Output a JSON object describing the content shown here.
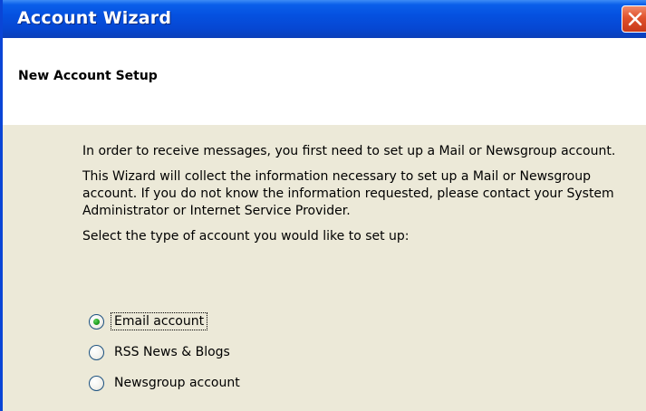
{
  "window": {
    "title": "Account Wizard"
  },
  "header": {
    "title": "New Account Setup"
  },
  "body": {
    "para1": "In order to receive messages, you first need to set up a Mail or Newsgroup account.",
    "para2": "This Wizard will collect the information necessary to set up a Mail or Newsgroup account. If you do not know the information requested, please contact your System Administrator or Internet Service Provider.",
    "prompt": "Select the type of account you would like to set up:"
  },
  "options": [
    {
      "label": "Email account",
      "checked": true
    },
    {
      "label": "RSS News & Blogs",
      "checked": false
    },
    {
      "label": "Newsgroup account",
      "checked": false
    }
  ],
  "icons": {
    "close": "close-icon"
  },
  "colors": {
    "titlebar": "#0551e0",
    "close_button": "#e0512c",
    "body_bg": "#ece9d8"
  }
}
